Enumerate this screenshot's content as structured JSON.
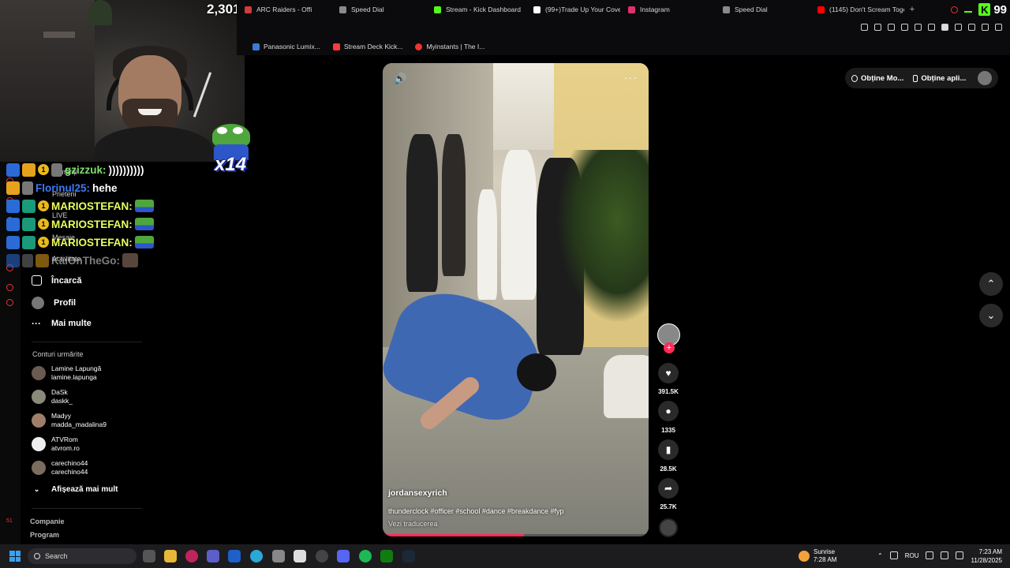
{
  "stream": {
    "viewer_count": "2,301",
    "emote_multiplier": "x14",
    "kick_count": "99"
  },
  "tabs": [
    {
      "label": "ARC Raiders - Offi",
      "color": "#d23b3b"
    },
    {
      "label": "Speed Dial",
      "color": "#8a8a8a"
    },
    {
      "label": "Stream - Kick Dashboard",
      "color": "#53fc18"
    },
    {
      "label": "(99+)Trade Up Your Cove",
      "color": "#ffffff"
    },
    {
      "label": "Instagram",
      "color": "#e1306c"
    },
    {
      "label": "Speed Dial",
      "color": "#8a8a8a"
    },
    {
      "label": "(1145) Don't Scream Toge",
      "color": "#ff0000"
    }
  ],
  "new_tab_label": "+",
  "bookmarks": [
    {
      "label": "Panasonic Lumix...",
      "color": "#3a7bd5"
    },
    {
      "label": "Stream Deck Kick...",
      "color": "#ff3b3b"
    },
    {
      "label": "Myinstants | The I...",
      "color": "#e33"
    }
  ],
  "chat": [
    {
      "user": "gzizzuk:",
      "message": "))))))))))",
      "color": "#7fe06c"
    },
    {
      "user": "Florinul25:",
      "message": "hehe",
      "color": "#3c7bf5"
    },
    {
      "user": "MARIOSTEFAN:",
      "message": "",
      "color": "#e9ff5c"
    },
    {
      "user": "MARIOSTEFAN:",
      "message": "",
      "color": "#e9ff5c"
    },
    {
      "user": "MARIOSTEFAN:",
      "message": "",
      "color": "#e9ff5c"
    },
    {
      "user": "KaiOnTheGo:",
      "message": "",
      "color": "#e0e0e0"
    }
  ],
  "coin_badge": "1",
  "sidebar": {
    "faint_items": [
      "Urmăriți",
      "Prieteni",
      "LIVE",
      "Mesaje",
      "Activitate"
    ],
    "upload": "Încarcă",
    "profile": "Profil",
    "more": "Mai multe",
    "following_title": "Conturi urmărite",
    "following": [
      {
        "name": "Lamine Lapungă",
        "handle": "lamine.lapunga"
      },
      {
        "name": "DaSk",
        "handle": "daskk_"
      },
      {
        "name": "Madyy",
        "handle": "madda_madalina9"
      },
      {
        "name": "ATVRom",
        "handle": "atvrom.ro"
      },
      {
        "name": "carechino44",
        "handle": "carechino44"
      }
    ],
    "show_more": "Afișează mai mult",
    "company": "Companie",
    "program": "Program",
    "rail_badge": "51"
  },
  "video": {
    "author": "jordansexyrich",
    "caption": "thunderclock #officer #school #dance #breakdance #fyp",
    "translate": "Vezi traducerea",
    "progress_fraction": 0.53
  },
  "actions": {
    "plus": "+",
    "likes": "391.5K",
    "comments": "1335",
    "saves": "28.5K",
    "shares": "25.7K"
  },
  "top_pills": {
    "get_mode": "Obține Mo...",
    "get_app": "Obține apli..."
  },
  "taskbar": {
    "search": "Search",
    "weather_title": "Sunrise",
    "weather_time": "7:28 AM",
    "notif_badge": "1",
    "language": "ROU",
    "time": "7:23 AM",
    "date": "11/28/2025"
  },
  "colors": {
    "tiktok_red": "#fe2c55",
    "kick_green": "#53fc18",
    "taskbar_bg": "#1c1c1f"
  }
}
